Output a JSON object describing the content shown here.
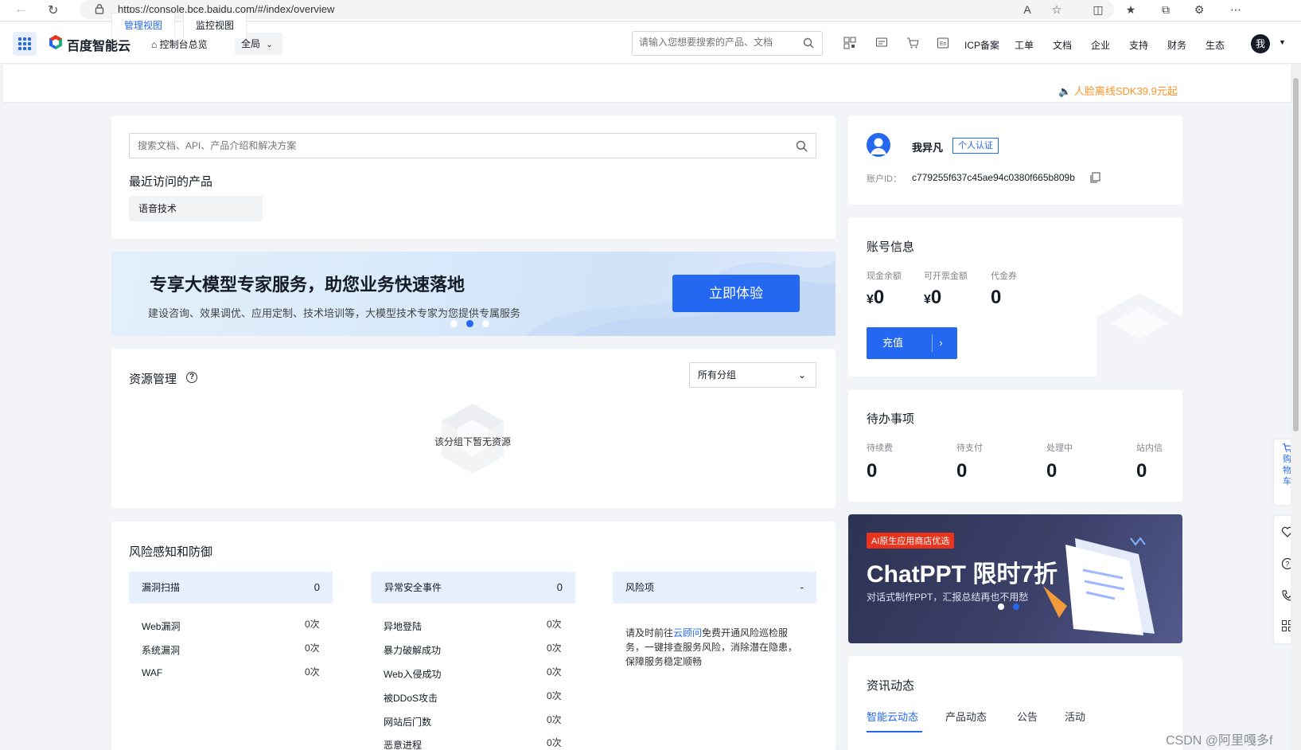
{
  "browser": {
    "url": "https://console.bce.baidu.com/#/index/overview"
  },
  "topnav": {
    "brand": "百度智能云",
    "home_label": "控制台总览",
    "region_label": "全局",
    "search_placeholder": "请输入您想要搜索的产品、文档",
    "links": [
      "ICP备案",
      "工单",
      "文档",
      "企业",
      "支持",
      "财务",
      "生态"
    ],
    "avatar_text": "我"
  },
  "view_tabs": [
    "管理视图",
    "监控视图"
  ],
  "promo_text": "人脸离线SDK39.9元起",
  "search_card": {
    "placeholder": "搜索文档、API、产品介绍和解决方案",
    "recent_title": "最近访问的产品",
    "recent_items": [
      "语音技术"
    ]
  },
  "banner": {
    "title": "专享大模型专家服务，助您业务快速落地",
    "subtitle": "建设咨询、效果调优、应用定制、技术培训等，大模型技术专家为您提供专属服务",
    "button": "立即体验",
    "active_index": 1,
    "dots": 3
  },
  "resources": {
    "title": "资源管理",
    "group_select": "所有分组",
    "empty_text": "该分组下暂无资源"
  },
  "risk": {
    "title": "风险感知和防御",
    "columns": [
      {
        "head": "漏洞扫描",
        "value": "0",
        "items": [
          [
            "Web漏洞",
            "0次"
          ],
          [
            "系统漏洞",
            "0次"
          ],
          [
            "WAF",
            "0次"
          ]
        ]
      },
      {
        "head": "异常安全事件",
        "value": "0",
        "items": [
          [
            "异地登陆",
            "0次"
          ],
          [
            "暴力破解成功",
            "0次"
          ],
          [
            "Web入侵成功",
            "0次"
          ],
          [
            "被DDoS攻击",
            "0次"
          ],
          [
            "网站后门数",
            "0次"
          ],
          [
            "恶意进程",
            "0次"
          ]
        ]
      },
      {
        "head": "风险项",
        "value": "-",
        "items": []
      }
    ],
    "note_prefix": "请及时前往",
    "note_link": "云顾问",
    "note_suffix": "免费开通风险巡检服务，一键排查服务风险，消除潜在隐患，保障服务稳定顺畅"
  },
  "user": {
    "name": "我异凡",
    "badge": "个人认证",
    "id_label": "账户ID：",
    "id": "c779255f637c45ae94c0380f665b809b"
  },
  "account": {
    "title": "账号信息",
    "items": [
      {
        "label": "现金余额",
        "currency": "¥",
        "value": "0"
      },
      {
        "label": "可开票金额",
        "currency": "¥",
        "value": "0"
      },
      {
        "label": "代金券",
        "currency": "",
        "value": "0"
      }
    ],
    "recharge": "充值"
  },
  "todo": {
    "title": "待办事项",
    "items": [
      {
        "label": "待续费",
        "value": "0"
      },
      {
        "label": "待支付",
        "value": "0"
      },
      {
        "label": "处理中",
        "value": "0"
      },
      {
        "label": "站内信",
        "value": "0"
      }
    ]
  },
  "ad": {
    "tag": "AI原生应用商店优选",
    "title": "ChatPPT 限时7折",
    "subtitle": "对话式制作PPT，汇报总结再也不用愁"
  },
  "news": {
    "title": "资讯动态",
    "tabs": [
      "智能云动态",
      "产品动态",
      "公告",
      "活动"
    ]
  },
  "dock": {
    "cart_label": "购物车"
  },
  "watermark": "CSDN @阿里嘎多f",
  "colors": {
    "primary": "#2468f2",
    "promo": "#ff9326",
    "ad_tag": "#e8341c"
  }
}
